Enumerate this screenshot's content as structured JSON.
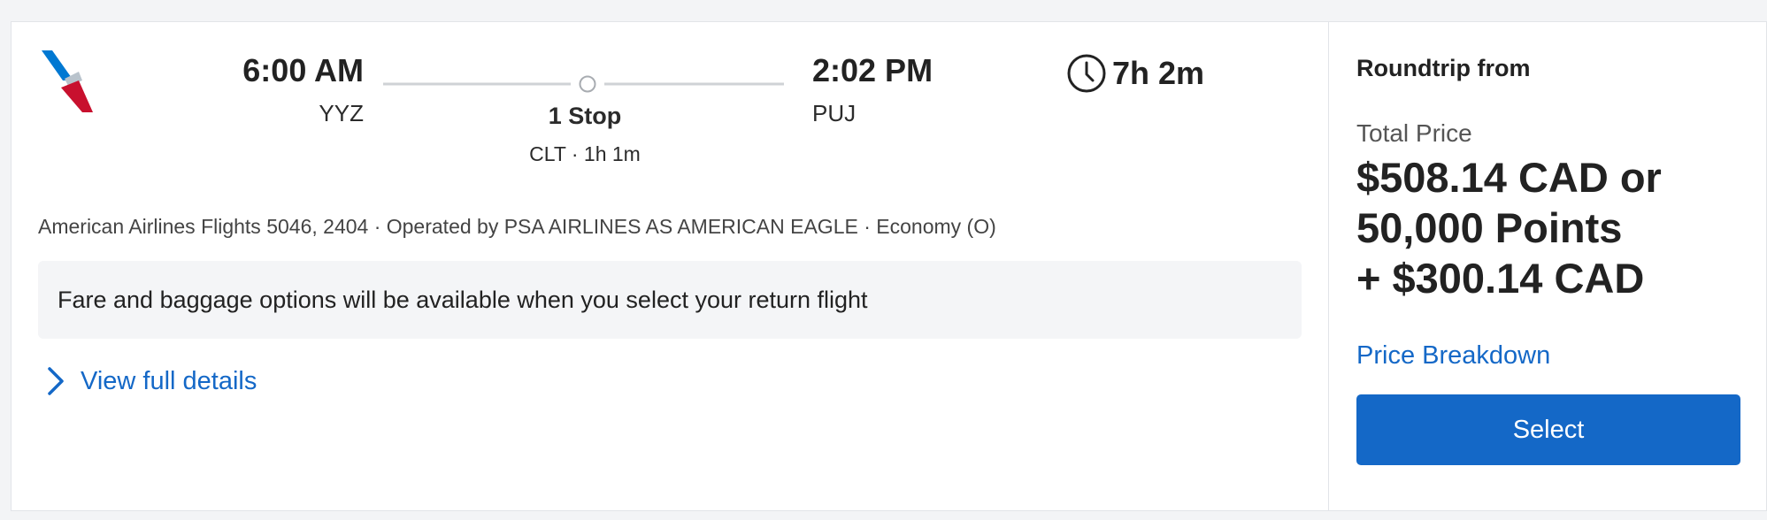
{
  "flight": {
    "airline_logo_icon": "american-airlines-logo",
    "departure": {
      "time": "6:00 AM",
      "airport": "YYZ"
    },
    "arrival": {
      "time": "2:02 PM",
      "airport": "PUJ"
    },
    "stops": {
      "label": "1 Stop",
      "detail": "CLT · 1h 1m"
    },
    "duration": {
      "icon": "clock-icon",
      "text": "7h 2m"
    },
    "info": "American Airlines Flights 5046, 2404 · Operated by PSA AIRLINES AS AMERICAN EAGLE · Economy (O)",
    "fare_notice": "Fare and baggage options will be available when you select your return flight",
    "details_link": {
      "icon": "chevron-right-icon",
      "label": "View full details"
    }
  },
  "pricing": {
    "roundtrip_label": "Roundtrip from",
    "total_label": "Total Price",
    "price_lines": [
      "$508.14 CAD or",
      "50,000 Points",
      "+ $300.14 CAD"
    ],
    "breakdown_link": "Price Breakdown",
    "select_button": "Select"
  },
  "colors": {
    "accent_blue": "#1468c7",
    "aa_red": "#c8102e",
    "aa_blue": "#0078d2",
    "fare_box_bg": "#f4f5f7"
  }
}
